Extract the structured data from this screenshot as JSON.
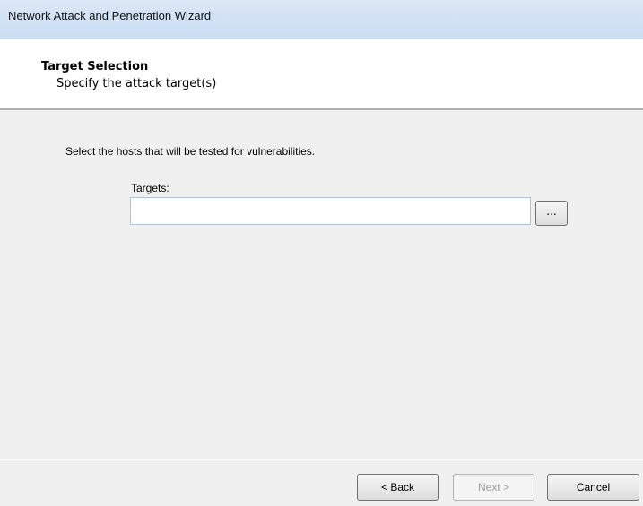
{
  "window": {
    "title": "Network Attack and Penetration Wizard"
  },
  "header": {
    "title": "Target Selection",
    "subtitle": "Specify the attack target(s)"
  },
  "main": {
    "instruction": "Select the hosts that will be tested for vulnerabilities.",
    "targets_label": "Targets:",
    "targets_value": "",
    "browse_label": "..."
  },
  "footer": {
    "back_label": "< Back",
    "next_label": "Next >",
    "cancel_label": "Cancel",
    "next_enabled": false
  }
}
